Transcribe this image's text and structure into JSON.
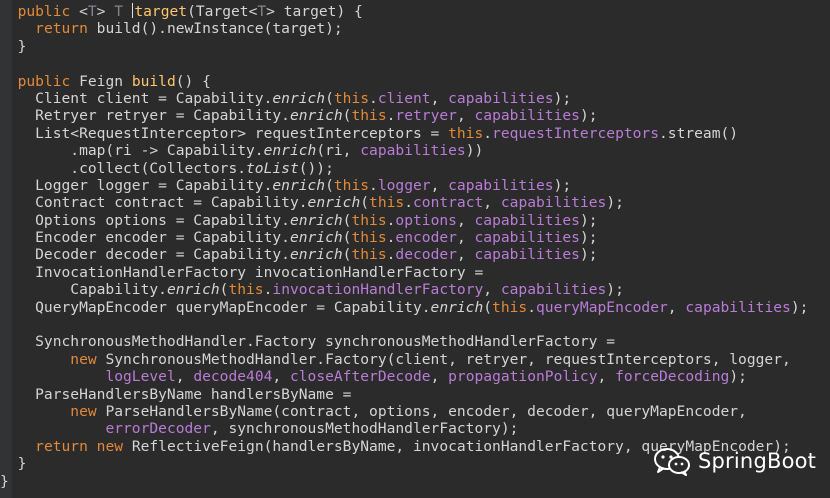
{
  "editor": {
    "language": "java",
    "colors": {
      "background": "#2b2b2b",
      "keyword": "#e2893a",
      "field": "#b97cd6",
      "method_declaration": "#ffc66d",
      "plain": "#d4d4d4",
      "type_param": "#7f858d"
    },
    "lines": [
      [
        {
          "t": "  "
        },
        {
          "t": "public",
          "c": "kw"
        },
        {
          "t": " <"
        },
        {
          "t": "T",
          "c": "muted"
        },
        {
          "t": "> "
        },
        {
          "t": "T",
          "c": "muted"
        },
        {
          "t": " "
        },
        {
          "t": "|CARET|"
        },
        {
          "t": "target",
          "c": "fn"
        },
        {
          "t": "(Target<"
        },
        {
          "t": "T",
          "c": "muted"
        },
        {
          "t": "> target) {"
        }
      ],
      [
        {
          "t": "    "
        },
        {
          "t": "return",
          "c": "kw"
        },
        {
          "t": " build().newInstance(target);"
        }
      ],
      [
        {
          "t": "  }"
        }
      ],
      [
        {
          "t": ""
        }
      ],
      [
        {
          "t": "  "
        },
        {
          "t": "public",
          "c": "kw"
        },
        {
          "t": " Feign "
        },
        {
          "t": "build",
          "c": "fn"
        },
        {
          "t": "() {"
        }
      ],
      [
        {
          "t": "    Client client = Capability."
        },
        {
          "t": "enrich",
          "c": "it"
        },
        {
          "t": "("
        },
        {
          "t": "this",
          "c": "kw"
        },
        {
          "t": "."
        },
        {
          "t": "client",
          "c": "field"
        },
        {
          "t": ", "
        },
        {
          "t": "capabilities",
          "c": "field"
        },
        {
          "t": ");"
        }
      ],
      [
        {
          "t": "    Retryer retryer = Capability."
        },
        {
          "t": "enrich",
          "c": "it"
        },
        {
          "t": "("
        },
        {
          "t": "this",
          "c": "kw"
        },
        {
          "t": "."
        },
        {
          "t": "retryer",
          "c": "field"
        },
        {
          "t": ", "
        },
        {
          "t": "capabilities",
          "c": "field"
        },
        {
          "t": ");"
        }
      ],
      [
        {
          "t": "    List<RequestInterceptor> requestInterceptors = "
        },
        {
          "t": "this",
          "c": "kw"
        },
        {
          "t": "."
        },
        {
          "t": "requestInterceptors",
          "c": "field"
        },
        {
          "t": ".stream()"
        }
      ],
      [
        {
          "t": "        .map(ri -> Capability."
        },
        {
          "t": "enrich",
          "c": "it"
        },
        {
          "t": "(ri, "
        },
        {
          "t": "capabilities",
          "c": "field"
        },
        {
          "t": "))"
        }
      ],
      [
        {
          "t": "        .collect(Collectors."
        },
        {
          "t": "toList",
          "c": "it"
        },
        {
          "t": "());"
        }
      ],
      [
        {
          "t": "    Logger logger = Capability."
        },
        {
          "t": "enrich",
          "c": "it"
        },
        {
          "t": "("
        },
        {
          "t": "this",
          "c": "kw"
        },
        {
          "t": "."
        },
        {
          "t": "logger",
          "c": "field"
        },
        {
          "t": ", "
        },
        {
          "t": "capabilities",
          "c": "field"
        },
        {
          "t": ");"
        }
      ],
      [
        {
          "t": "    Contract contract = Capability."
        },
        {
          "t": "enrich",
          "c": "it"
        },
        {
          "t": "("
        },
        {
          "t": "this",
          "c": "kw"
        },
        {
          "t": "."
        },
        {
          "t": "contract",
          "c": "field"
        },
        {
          "t": ", "
        },
        {
          "t": "capabilities",
          "c": "field"
        },
        {
          "t": ");"
        }
      ],
      [
        {
          "t": "    Options options = Capability."
        },
        {
          "t": "enrich",
          "c": "it"
        },
        {
          "t": "("
        },
        {
          "t": "this",
          "c": "kw"
        },
        {
          "t": "."
        },
        {
          "t": "options",
          "c": "field"
        },
        {
          "t": ", "
        },
        {
          "t": "capabilities",
          "c": "field"
        },
        {
          "t": ");"
        }
      ],
      [
        {
          "t": "    Encoder encoder = Capability."
        },
        {
          "t": "enrich",
          "c": "it"
        },
        {
          "t": "("
        },
        {
          "t": "this",
          "c": "kw"
        },
        {
          "t": "."
        },
        {
          "t": "encoder",
          "c": "field"
        },
        {
          "t": ", "
        },
        {
          "t": "capabilities",
          "c": "field"
        },
        {
          "t": ");"
        }
      ],
      [
        {
          "t": "    Decoder decoder = Capability."
        },
        {
          "t": "enrich",
          "c": "it"
        },
        {
          "t": "("
        },
        {
          "t": "this",
          "c": "kw"
        },
        {
          "t": "."
        },
        {
          "t": "decoder",
          "c": "field"
        },
        {
          "t": ", "
        },
        {
          "t": "capabilities",
          "c": "field"
        },
        {
          "t": ");"
        }
      ],
      [
        {
          "t": "    InvocationHandlerFactory invocationHandlerFactory ="
        }
      ],
      [
        {
          "t": "        Capability."
        },
        {
          "t": "enrich",
          "c": "it"
        },
        {
          "t": "("
        },
        {
          "t": "this",
          "c": "kw"
        },
        {
          "t": "."
        },
        {
          "t": "invocationHandlerFactory",
          "c": "field"
        },
        {
          "t": ", "
        },
        {
          "t": "capabilities",
          "c": "field"
        },
        {
          "t": ");"
        }
      ],
      [
        {
          "t": "    QueryMapEncoder queryMapEncoder = Capability."
        },
        {
          "t": "enrich",
          "c": "it"
        },
        {
          "t": "("
        },
        {
          "t": "this",
          "c": "kw"
        },
        {
          "t": "."
        },
        {
          "t": "queryMapEncoder",
          "c": "field"
        },
        {
          "t": ", "
        },
        {
          "t": "capabilities",
          "c": "field"
        },
        {
          "t": ");"
        }
      ],
      [
        {
          "t": ""
        }
      ],
      [
        {
          "t": "    SynchronousMethodHandler.Factory synchronousMethodHandlerFactory ="
        }
      ],
      [
        {
          "t": "        "
        },
        {
          "t": "new",
          "c": "kw"
        },
        {
          "t": " SynchronousMethodHandler.Factory(client, retryer, requestInterceptors, logger,"
        }
      ],
      [
        {
          "t": "            "
        },
        {
          "t": "logLevel",
          "c": "field"
        },
        {
          "t": ", "
        },
        {
          "t": "decode404",
          "c": "field"
        },
        {
          "t": ", "
        },
        {
          "t": "closeAfterDecode",
          "c": "field"
        },
        {
          "t": ", "
        },
        {
          "t": "propagationPolicy",
          "c": "field"
        },
        {
          "t": ", "
        },
        {
          "t": "forceDecoding",
          "c": "field"
        },
        {
          "t": ");"
        }
      ],
      [
        {
          "t": "    ParseHandlersByName handlersByName ="
        }
      ],
      [
        {
          "t": "        "
        },
        {
          "t": "new",
          "c": "kw"
        },
        {
          "t": " ParseHandlersByName(contract, options, encoder, decoder, queryMapEncoder,"
        }
      ],
      [
        {
          "t": "            "
        },
        {
          "t": "errorDecoder",
          "c": "field"
        },
        {
          "t": ", synchronousMethodHandlerFactory);"
        }
      ],
      [
        {
          "t": "    "
        },
        {
          "t": "return",
          "c": "kw"
        },
        {
          "t": " "
        },
        {
          "t": "new",
          "c": "kw"
        },
        {
          "t": " ReflectiveFeign(handlersByName, invocationHandlerFactory, queryMapEncoder);"
        }
      ],
      [
        {
          "t": "  }"
        }
      ],
      [
        {
          "t": "}"
        }
      ]
    ]
  },
  "watermark": {
    "text": "SpringBoot",
    "icon": "wechat-icon"
  }
}
